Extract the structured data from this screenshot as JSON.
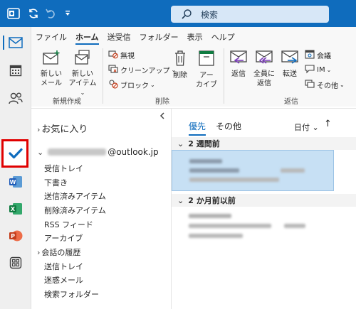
{
  "titlebar": {
    "search_placeholder": "検索"
  },
  "ribbon": {
    "menu_tabs": [
      "ファイル",
      "ホーム",
      "送受信",
      "フォルダー",
      "表示",
      "ヘルプ"
    ],
    "new_mail": [
      "新しい",
      "メール"
    ],
    "new_item": [
      "新しい",
      "アイテム"
    ],
    "new_group_label": "新規作成",
    "ignore": "無視",
    "cleanup": "クリーンアップ",
    "block": "ブロック",
    "delete": "削除",
    "archive": [
      "アー",
      "カイブ"
    ],
    "delete_group_label": "削除",
    "reply": "返信",
    "reply_all": [
      "全員に",
      "返信"
    ],
    "forward": "転送",
    "meeting": "会議",
    "im": "IM",
    "more": "その他",
    "reply_group_label": "返信"
  },
  "folders": {
    "favorites": "お気に入り",
    "account_suffix": "@outlook.jp",
    "items": [
      "受信トレイ",
      "下書き",
      "送信済みアイテム",
      "削除済みアイテム",
      "RSS フィード",
      "アーカイブ",
      "会話の履歴",
      "送信トレイ",
      "迷惑メール",
      "検索フォルダー"
    ]
  },
  "messages": {
    "tab_focused": "優先",
    "tab_other": "その他",
    "sort_label": "日付",
    "group1": "2 週間前",
    "group2": "2 か月前以前"
  },
  "colors": {
    "brand": "#0f6cbd",
    "selection_outline": "#e00000",
    "selected_mail": "#c7e0f4"
  }
}
